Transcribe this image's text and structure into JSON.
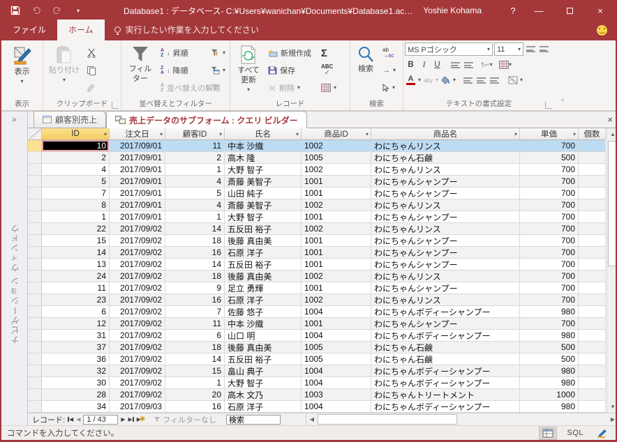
{
  "window_title": "Database1 : データベース- C:¥Users¥wanichan¥Documents¥Database1.ac…",
  "user_name": "Yoshie Kohama",
  "help_label": "?",
  "file_tab": "ファイル",
  "home_tab": "ホーム",
  "tellme": "実行したい作業を入力してください",
  "ribbon": {
    "view": "表示",
    "view_group": "表示",
    "paste": "貼り付け",
    "clipboard_group": "クリップボード",
    "filter": "フィルター",
    "asc": "昇順",
    "desc": "降順",
    "clear_sort": "並べ替えの解除",
    "sortfilter_group": "並べ替えとフィルター",
    "refresh_all": "すべて 更新",
    "new": "新規作成",
    "save": "保存",
    "delete": "削除",
    "records_group": "レコード",
    "sigma": "Σ",
    "abc": "ABC",
    "find": "検索",
    "find_group": "検索",
    "replace_ab": "ab",
    "replace_ac": "ac",
    "font_name": "MS Pゴシック",
    "font_size": "11",
    "bold": "B",
    "italic": "I",
    "underline": "U",
    "font_color": "A",
    "highlight": "aby",
    "text_group": "テキストの書式設定",
    "sort_a": "A",
    "sort_z": "Z"
  },
  "nav_pane_label": "ナビゲーション ウィンドウ",
  "doc_tabs": {
    "tab1": "顧客別売上",
    "tab2": "売上データのサブフォーム : クエリ ビルダー"
  },
  "table": {
    "columns": [
      "ID",
      "注文日",
      "顧客ID",
      "氏名",
      "商品ID",
      "商品名",
      "単価",
      "個数"
    ],
    "selected_cell": "10",
    "rows": [
      [
        "10",
        "2017/09/01",
        "11",
        "中本 沙織",
        "1002",
        "わにちゃんリンス",
        "700"
      ],
      [
        "2",
        "2017/09/01",
        "2",
        "高木 隆",
        "1005",
        "わにちゃん石鹸",
        "500"
      ],
      [
        "4",
        "2017/09/01",
        "1",
        "大野 智子",
        "1002",
        "わにちゃんリンス",
        "700"
      ],
      [
        "5",
        "2017/09/01",
        "4",
        "斎藤 美智子",
        "1001",
        "わにちゃんシャンプー",
        "700"
      ],
      [
        "7",
        "2017/09/01",
        "5",
        "山田 純子",
        "1001",
        "わにちゃんシャンプー",
        "700"
      ],
      [
        "8",
        "2017/09/01",
        "4",
        "斎藤 美智子",
        "1002",
        "わにちゃんリンス",
        "700"
      ],
      [
        "1",
        "2017/09/01",
        "1",
        "大野 智子",
        "1001",
        "わにちゃんシャンプー",
        "700"
      ],
      [
        "22",
        "2017/09/02",
        "14",
        "五反田 裕子",
        "1002",
        "わにちゃんリンス",
        "700"
      ],
      [
        "15",
        "2017/09/02",
        "18",
        "後藤 真由美",
        "1001",
        "わにちゃんシャンプー",
        "700"
      ],
      [
        "14",
        "2017/09/02",
        "16",
        "石原 洋子",
        "1001",
        "わにちゃんシャンプー",
        "700"
      ],
      [
        "13",
        "2017/09/02",
        "14",
        "五反田 裕子",
        "1001",
        "わにちゃんシャンプー",
        "700"
      ],
      [
        "24",
        "2017/09/02",
        "18",
        "後藤 真由美",
        "1002",
        "わにちゃんリンス",
        "700"
      ],
      [
        "11",
        "2017/09/02",
        "9",
        "足立 勇輝",
        "1001",
        "わにちゃんシャンプー",
        "700"
      ],
      [
        "23",
        "2017/09/02",
        "16",
        "石原 洋子",
        "1002",
        "わにちゃんリンス",
        "700"
      ],
      [
        "6",
        "2017/09/02",
        "7",
        "佐藤 悠子",
        "1004",
        "わにちゃんボディーシャンプー",
        "980"
      ],
      [
        "12",
        "2017/09/02",
        "11",
        "中本 沙織",
        "1001",
        "わにちゃんシャンプー",
        "700"
      ],
      [
        "31",
        "2017/09/02",
        "6",
        "山口 明",
        "1004",
        "わにちゃんボディーシャンプー",
        "980"
      ],
      [
        "37",
        "2017/09/02",
        "18",
        "後藤 真由美",
        "1005",
        "わにちゃん石鹸",
        "500"
      ],
      [
        "36",
        "2017/09/02",
        "14",
        "五反田 裕子",
        "1005",
        "わにちゃん石鹸",
        "500"
      ],
      [
        "32",
        "2017/09/02",
        "15",
        "畠山 典子",
        "1004",
        "わにちゃんボディーシャンプー",
        "980"
      ],
      [
        "30",
        "2017/09/02",
        "1",
        "大野 智子",
        "1004",
        "わにちゃんボディーシャンプー",
        "980"
      ],
      [
        "28",
        "2017/09/02",
        "20",
        "高木 文乃",
        "1003",
        "わにちゃんトリートメント",
        "1000"
      ],
      [
        "34",
        "2017/09/03",
        "16",
        "石原 洋子",
        "1004",
        "わにちゃんボディーシャンプー",
        "980"
      ]
    ]
  },
  "record_nav": {
    "label": "レコード:",
    "position": "1 / 43",
    "filter_state": "フィルターなし",
    "search": "検索"
  },
  "status": {
    "message": "コマンドを入力してください。",
    "sql": "SQL"
  },
  "colors": {
    "accent": "#A4373A",
    "row_selected": "#BCDCF4",
    "header_selected": "#F8D778"
  }
}
